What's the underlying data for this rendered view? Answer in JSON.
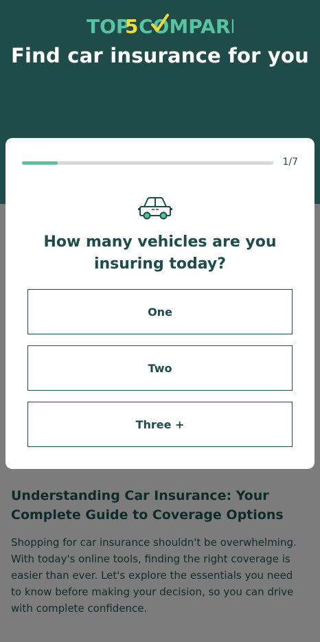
{
  "brand": {
    "logo_text_part1": "TOP",
    "logo_text_number": "5",
    "logo_text_part2": "COMPARE",
    "colors": {
      "primary": "#1f4c49",
      "accent": "#57c3a0",
      "logo_number": "#f2d93b"
    }
  },
  "hero": {
    "title": "Find car insurance for you"
  },
  "quiz": {
    "progress": {
      "current": 1,
      "total": 7,
      "fraction": 0.143,
      "label": "1/7"
    },
    "icon": "car-icon",
    "question": "How many vehicles are you insuring today?",
    "options": [
      {
        "label": "One"
      },
      {
        "label": "Two"
      },
      {
        "label": "Three +"
      }
    ]
  },
  "article": {
    "heading": "Understanding Car Insurance: Your Complete Guide to Coverage Options",
    "body": "Shopping for car insurance shouldn't be overwhelming. With today's online tools, finding the right coverage is easier than ever. Let's explore the essentials you need to know before making your decision, so you can drive with complete confidence."
  }
}
